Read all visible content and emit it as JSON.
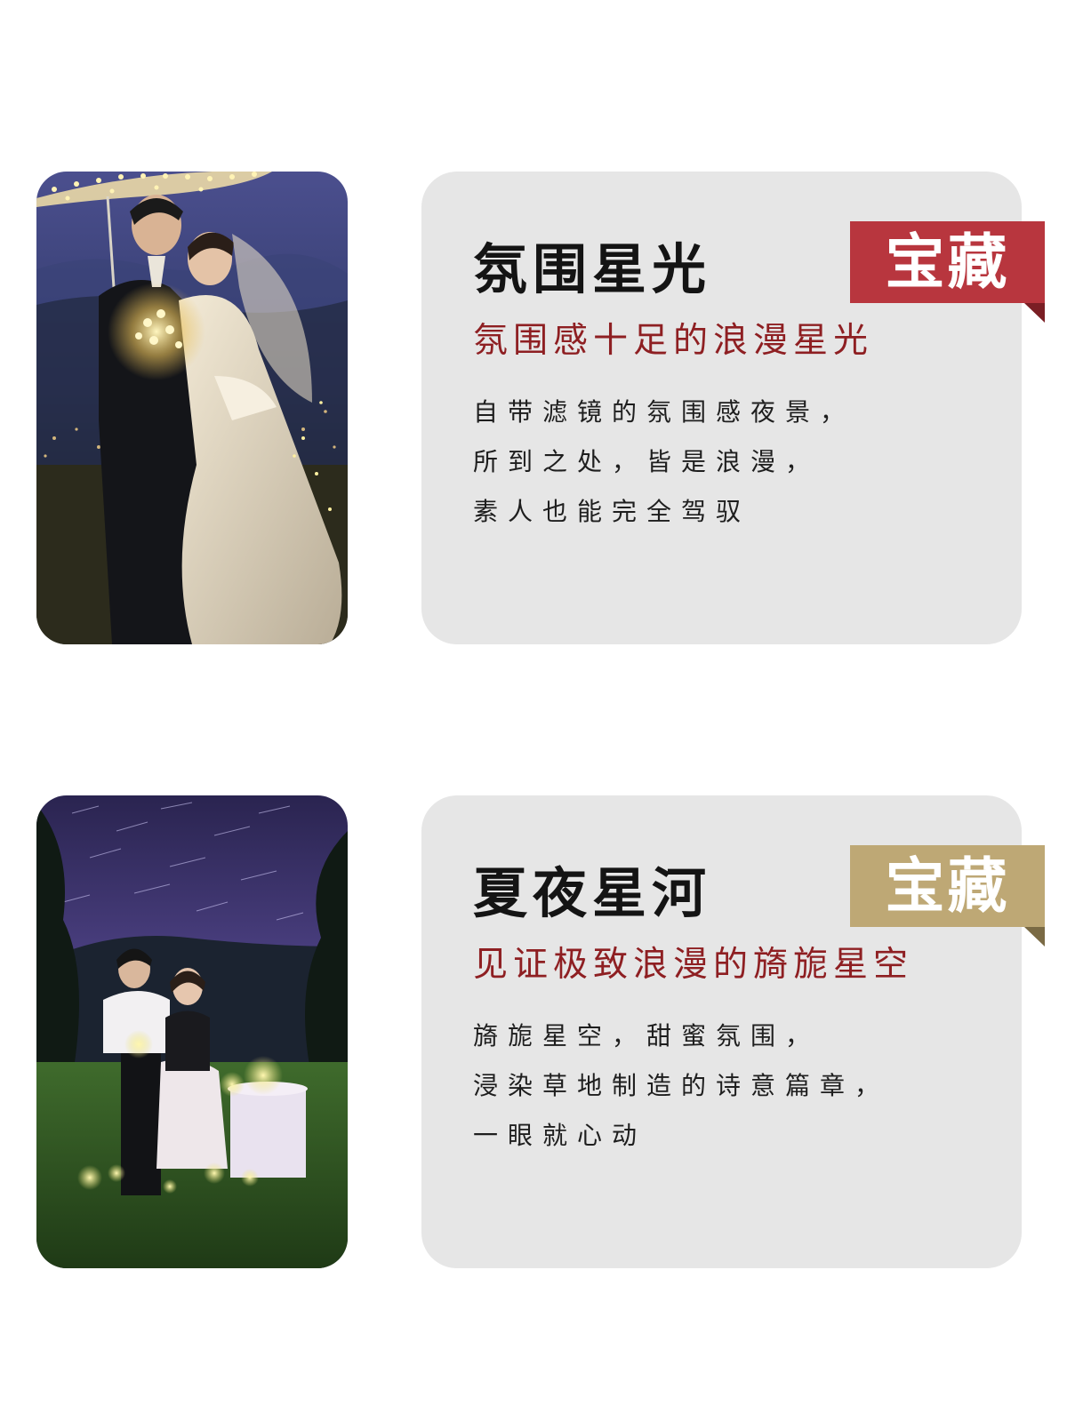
{
  "sections": [
    {
      "title": "氛围星光",
      "badge": "宝藏",
      "badge_color": "#b8363e",
      "badge_fold_color": "#7a1e24",
      "subtitle": "氛围感十足的浪漫星光",
      "lines": [
        "自带滤镜的氛围感夜景，",
        "所到之处，皆是浪漫，",
        "素人也能完全驾驭"
      ]
    },
    {
      "title": "夏夜星河",
      "badge": "宝藏",
      "badge_color": "#bea875",
      "badge_fold_color": "#7a6a44",
      "subtitle": "见证极致浪漫的旖旎星空",
      "lines": [
        "旖旎星空，甜蜜氛围，",
        "浸染草地制造的诗意篇章，",
        "一眼就心动"
      ]
    }
  ]
}
